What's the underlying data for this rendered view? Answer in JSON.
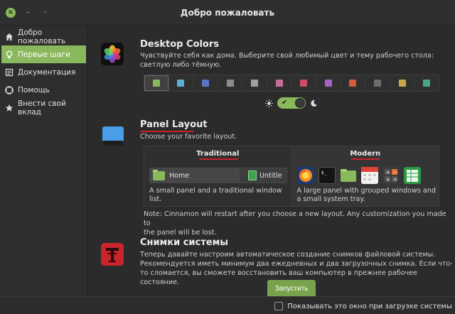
{
  "window": {
    "title": "Добро пожаловать"
  },
  "sidebar": {
    "items": [
      {
        "label": "Добро пожаловать",
        "icon": "home-icon"
      },
      {
        "label": "Первые шаги",
        "icon": "lightbulb-icon",
        "active": true
      },
      {
        "label": "Документация",
        "icon": "book-icon"
      },
      {
        "label": "Помощь",
        "icon": "lifebuoy-icon"
      },
      {
        "label": "Внести свой вклад",
        "icon": "star-icon"
      }
    ]
  },
  "colors": {
    "title": "Desktop Colors",
    "desc_line1": "Чувствуйте себя как дома. Выберите свой любимый цвет и тему рабочего стола:",
    "desc_line2": "светлую либо тёмную.",
    "swatches": [
      "#8ab85c",
      "#5aafd4",
      "#5b74c4",
      "#8c8c8c",
      "#a0a0a0",
      "#c76d9a",
      "#d04b68",
      "#a463c9",
      "#d25d3c",
      "#6d6d6d",
      "#c7a74b",
      "#46a58a"
    ],
    "selected_index": 0,
    "dark_mode": true
  },
  "panel_layout": {
    "title": "Panel Layout",
    "desc": "Choose your favorite layout.",
    "traditional": {
      "label": "Traditional",
      "win1": "Home",
      "win2": "Untitle",
      "desc_line1": "A small panel and a traditional window",
      "desc_line2": "list."
    },
    "modern": {
      "label": "Modern",
      "desc_line1": "A large panel with grouped windows and",
      "desc_line2": "a small system tray."
    },
    "note_line1": "Note: Cinnamon will restart after you choose a new layout. Any customization you made to",
    "note_line2": "the panel will be lost."
  },
  "snapshots": {
    "title": "Снимки системы",
    "desc_line1": "Теперь давайте настроим автоматическое создание снимков файловой системы.",
    "desc_line2": "Рекомендуется иметь минимум два ежедневных и два загрузочных снимка. Если что-",
    "desc_line3": "то сломается, вы сможете восстановить ваш компьютер в прежнее рабочее состояние.",
    "button": "Запустить"
  },
  "footer": {
    "checkbox_label": "Показывать это окно при загрузке системы",
    "checked": false
  },
  "theme": {
    "accent": "#8ab85c",
    "underline": "#cc1f2b"
  }
}
